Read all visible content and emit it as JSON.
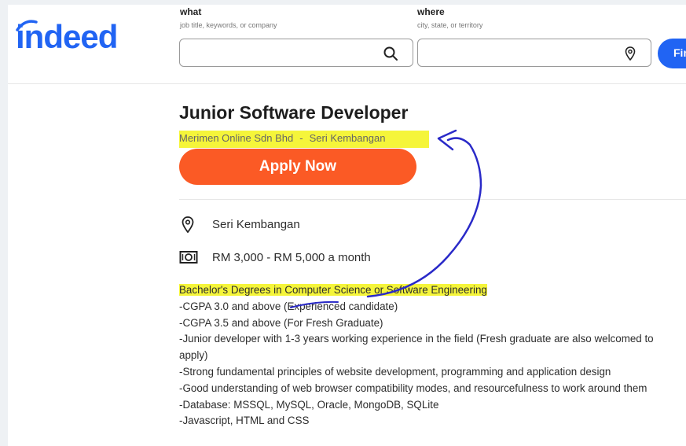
{
  "header": {
    "logo_text": "indeed",
    "what": {
      "label": "what",
      "hint": "job title, keywords, or company",
      "value": "",
      "search_icon": "search-icon"
    },
    "where": {
      "label": "where",
      "hint": "city, state, or territory",
      "value": "",
      "location_icon": "location-pin-icon"
    },
    "find_button_label": "Fin"
  },
  "job": {
    "title": "Junior Software Developer",
    "company": "Merimen Online Sdn Bhd",
    "separator": "-",
    "location_short": "Seri Kembangan",
    "apply_label": "Apply Now",
    "location": "Seri Kembangan",
    "salary": "RM 3,000 - RM 5,000 a month",
    "requirements": [
      "Bachelor's Degrees in Computer Science or Software Engineering",
      "-CGPA 3.0 and above (Experienced candidate)",
      "-CGPA 3.5 and above (For Fresh Graduate)",
      "-Junior developer with 1-3 years working experience in the field (Fresh graduate are also welcomed to apply)",
      "-Strong fundamental principles of website development, programming and application design",
      "-Good understanding of web browser compatibility modes, and resourcefulness to work around them",
      "-Database: MSSQL, MySQL, Oracle, MongoDB, SQLite",
      "-Javascript, HTML and CSS"
    ]
  },
  "colors": {
    "brand_blue": "#2164f3",
    "apply_orange": "#fb5a25",
    "highlight_yellow": "#f5f53a",
    "annotation_ink": "#2a2ac8"
  }
}
